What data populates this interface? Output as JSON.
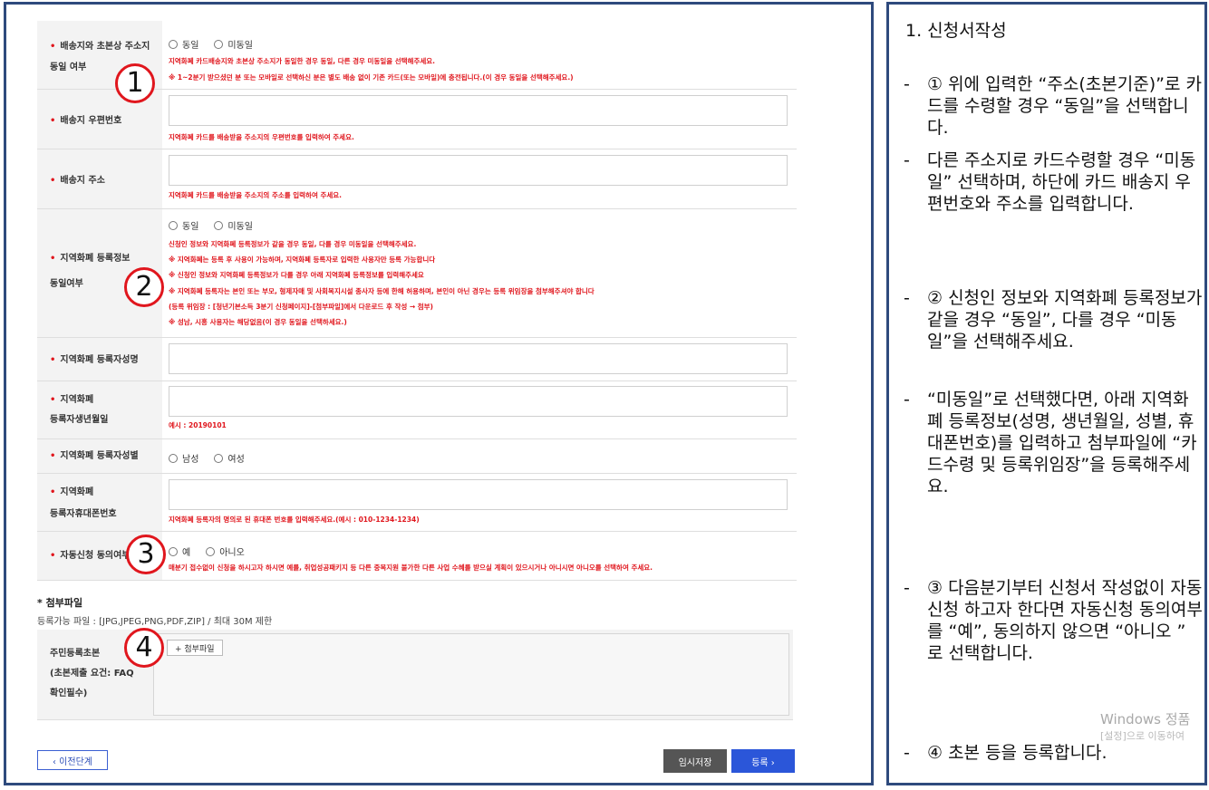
{
  "form": {
    "row1": {
      "label_line1": "배송지와 초본상 주소지",
      "label_line2": "동일 여부",
      "options": [
        "동일",
        "미동일"
      ],
      "notes": [
        "지역화폐 카드배송지와 초본상 주소지가 동일한 경우 동일, 다른 경우 미동일을 선택해주세요.",
        "※ 1~2분기 받으셨던 분 또는 모바일로 선택하신 분은 별도 배송 없이 기존 카드(또는 모바일)에 충전됩니다.(이 경우 동일을 선택해주세요.)"
      ]
    },
    "row2": {
      "label": "배송지 우편번호",
      "note": "지역화폐 카드를 배송받을 주소지의 우편번호를 입력하여 주세요."
    },
    "row3": {
      "label": "배송지 주소",
      "note": "지역화폐 카드를 배송받을 주소지의 주소를 입력하여 주세요."
    },
    "row4": {
      "label_line1": "지역화폐 등록정보",
      "label_line2": "동일여부",
      "options": [
        "동일",
        "미동일"
      ],
      "notes": [
        "신청인 정보와 지역화폐 등록정보가 같을 경우 동일, 다를 경우 미동일을 선택해주세요.",
        "※ 지역화폐는 등록 후 사용이 가능하며, 지역화폐 등록자로 입력한 사용자만 등록 가능합니다",
        "※ 신청인 정보와 지역화폐 등록정보가 다를 경우 아래 지역화폐 등록정보를 입력해주세요",
        "※ 지역화폐 등록자는 본인 또는 부모, 형제자매 및 사회복지시설 종사자 등에 한해 허용하며, 본인이 아닌 경우는 등록 위임장을 첨부해주셔야 합니다",
        "(등록 위임장 : [청년기본소득 3분기 신청페이지]-[첨부파일]에서 다운로드 후 작성 → 첨부)",
        "※ 성남, 시흥 사용자는 해당없음(이 경우 동일을 선택하세요.)"
      ]
    },
    "row5": {
      "label": "지역화폐 등록자성명"
    },
    "row6": {
      "label_line1": "지역화폐",
      "label_line2": "등록자생년월일",
      "note": "예시 : 20190101"
    },
    "row7": {
      "label": "지역화폐 등록자성별",
      "options": [
        "남성",
        "여성"
      ]
    },
    "row8": {
      "label_line1": "지역화폐",
      "label_line2": "등록자휴대폰번호",
      "note": "지역화폐 등록자의 명의로 된 휴대폰 번호를 입력해주세요.(예시 : 010-1234-1234)"
    },
    "row9": {
      "label": "자동신청 동의여부",
      "options": [
        "예",
        "아니오"
      ],
      "note": "매분기 접수없이 신청을 하시고자 하시면 예를, 취업성공패키지 등 다른 중복지원 불가한 다른 사업 수혜를 받으실 계획이 있으시거나 아니시면 아니오를 선택하여 주세요."
    },
    "attach": {
      "title": "* 첨부파일",
      "note": "등록가능 파일 : [JPG,JPEG,PNG,PDF,ZIP] / 최대 30M 제한",
      "label_lines": [
        "주민등록초본",
        "(초본제출 요건: FAQ",
        "확인필수)"
      ],
      "button": "+ 첨부파일"
    },
    "buttons": {
      "prev": "‹ 이전단계",
      "temp_save": "임시저장",
      "submit": "등록 ›"
    }
  },
  "markers": [
    "1",
    "2",
    "3",
    "4"
  ],
  "guide": {
    "title": "1.  신청서작성",
    "items": [
      "① 위에 입력한 “주소(초본기준)”로 카드를 수령할 경우 “동일”을 선택합니다.",
      "다른 주소지로 카드수령할 경우 “미동일” 선택하며, 하단에 카드 배송지 우편번호와 주소를 입력합니다.",
      " ② 신청인 정보와 지역화폐 등록정보가 같을 경우 “동일”, 다를 경우 “미동일”을 선택해주세요.",
      "“미동일”로 선택했다면, 아래 지역화폐 등록정보(성명, 생년월일, 성별, 휴대폰번호)를 입력하고 첨부파일에 “카드수령 및 등록위임장”을 등록해주세요.",
      "③ 다음분기부터 신청서 작성없이 자동신청 하고자 한다면 자동신청 동의여부를 “예”, 동의하지 않으면 “아니오 ” 로 선택합니다.",
      "④ 초본 등을 등록합니다."
    ],
    "dash": "-"
  },
  "watermark": {
    "line1": "Windows 정품",
    "line2": "[설정]으로 이동하여"
  }
}
